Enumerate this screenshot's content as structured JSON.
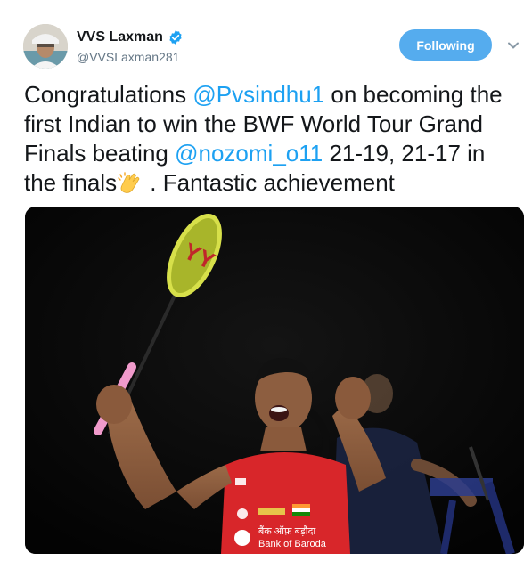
{
  "author": {
    "name": "VVS Laxman",
    "handle": "@VVSLaxman281"
  },
  "follow_button": {
    "label": "Following"
  },
  "icons": {
    "verified": "verified-badge-icon",
    "caret": "chevron-down-icon",
    "clap": "clapping-hands-emoji"
  },
  "tweet": {
    "text_1": "Congratulations ",
    "mention_1": "@Pvsindhu1",
    "text_2": " on becoming the first Indian to win the BWF World Tour Grand Finals beating ",
    "mention_2": "@nozomi_o11",
    "text_3": " 21-19, 21-17 in the finals",
    "text_4": " . Fantastic achievement"
  },
  "media": {
    "jersey_texts": {
      "sponsor_hindi": "बैंक ऑफ़ बड़ौदा",
      "sponsor_en": "Bank of Baroda"
    }
  },
  "colors": {
    "accent": "#1da1f2",
    "follow_bg": "#55acee",
    "verified": "#1da1f2",
    "jersey": "#d8262a"
  }
}
